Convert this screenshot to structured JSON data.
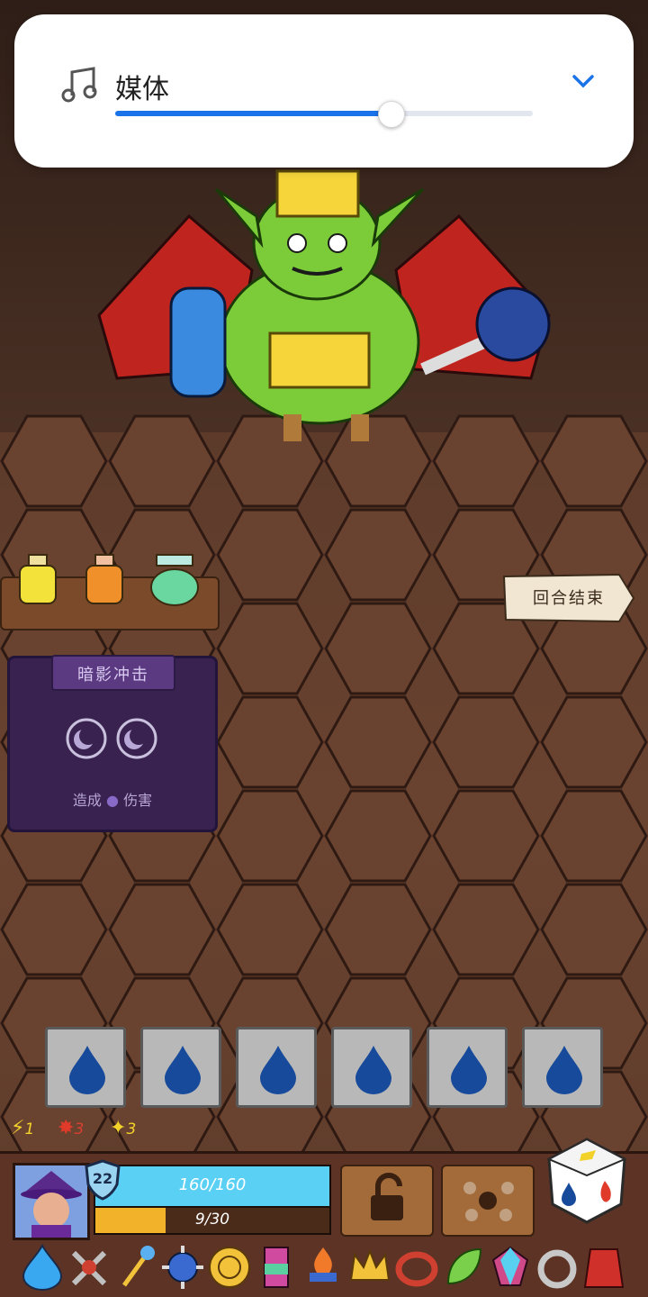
{
  "media_panel": {
    "label": "媒体",
    "icon": "music-note-icon",
    "collapse_icon": "chevron-down-icon",
    "volume_fraction": 0.66,
    "accent_color": "#1a73e8"
  },
  "battle": {
    "end_turn_label": "回合结束",
    "potions": [
      "yellow-potion",
      "orange-potion",
      "rainbow-potion"
    ]
  },
  "card": {
    "title": "暗影冲击",
    "desc_before": "造成",
    "desc_after": "伤害",
    "dice_icons": [
      "moon-icon",
      "moon-icon"
    ]
  },
  "dice_slots": [
    "water-drop-icon",
    "water-drop-icon",
    "water-drop-icon",
    "water-drop-icon",
    "water-drop-icon",
    "water-drop-icon"
  ],
  "status_effects": [
    {
      "icon": "lightning-icon",
      "value": "1"
    },
    {
      "icon": "fire-crack-icon",
      "value": "3"
    },
    {
      "icon": "spark-icon",
      "value": "3"
    }
  ],
  "player": {
    "level": "22",
    "hp_text": "160/160",
    "hp_fraction": 1.0,
    "exp_text": "9/30",
    "exp_fraction": 0.3
  },
  "relics": [
    "water-drop-relic",
    "crossed-swords-relic",
    "staff-relic",
    "spiked-ball-relic",
    "golden-orb-relic",
    "totem-relic",
    "flame-brazier-relic",
    "crown-relic",
    "ring-relic",
    "leaf-relic",
    "gem-relic",
    "silver-ring-relic",
    "red-cloak-relic"
  ]
}
